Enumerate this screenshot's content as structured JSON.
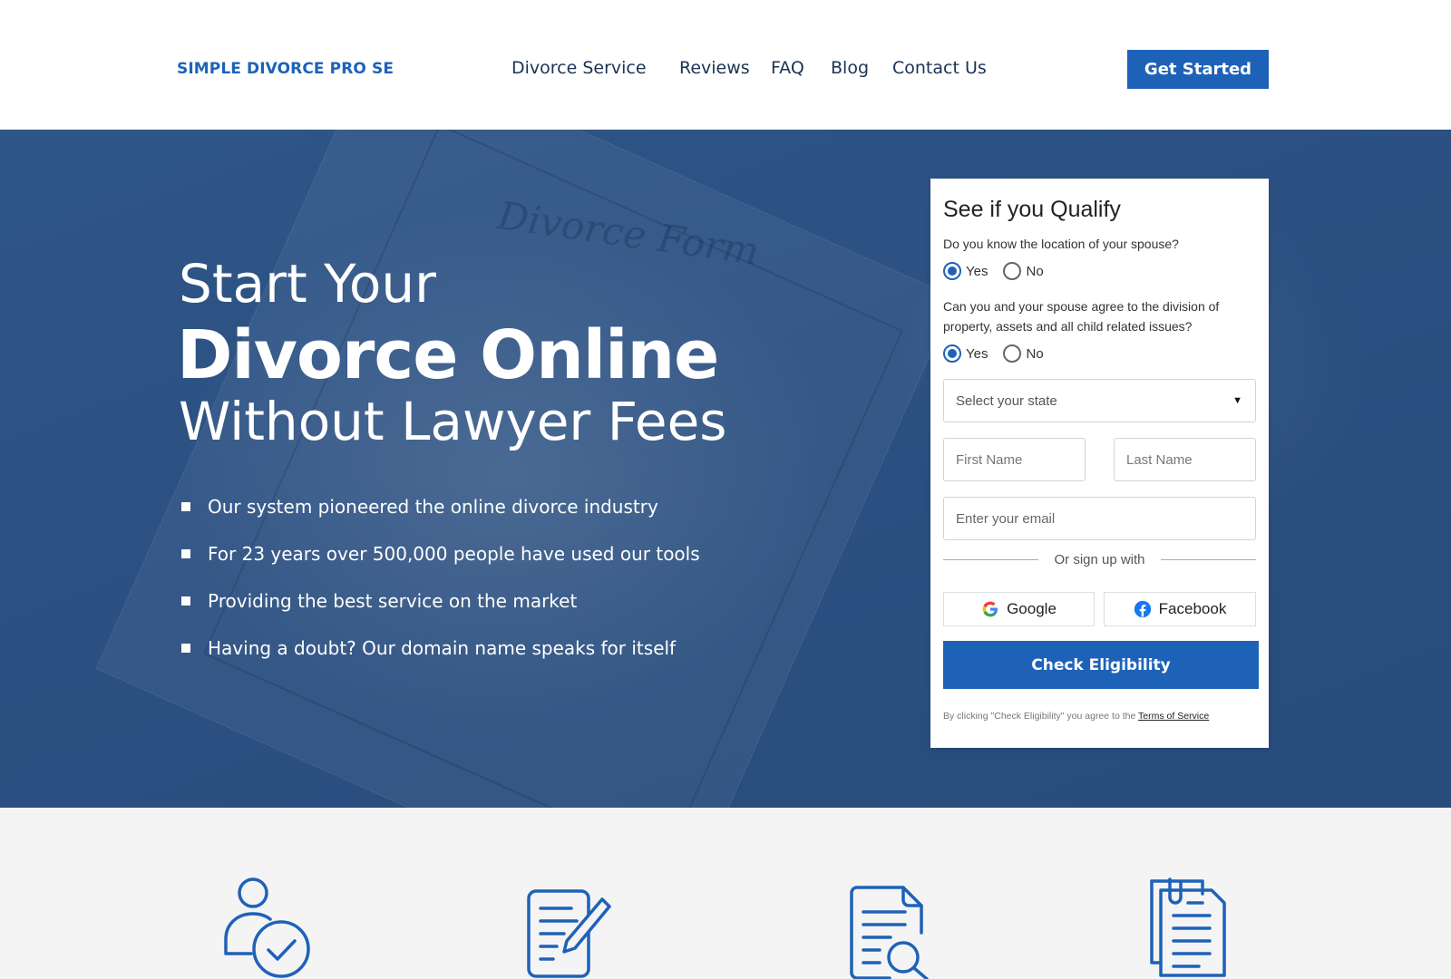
{
  "header": {
    "logo": "SIMPLE DIVORCE PRO SE",
    "nav": [
      "Divorce Service",
      "Reviews",
      "FAQ",
      "Blog",
      "Contact Us"
    ],
    "cta": "Get Started"
  },
  "hero": {
    "line1": "Start Your",
    "line2": "Divorce Online",
    "line3": "Without Lawyer Fees",
    "bullets": [
      "Our system pioneered the online divorce industry",
      "For 23 years over 500,000 people have used our tools",
      "Providing the best service on the market",
      "Having a doubt? Our domain name speaks for itself"
    ],
    "background_text": "Divorce Form"
  },
  "form": {
    "title": "See if you Qualify",
    "q1": "Do you know the location of your spouse?",
    "q2": "Can you and your spouse agree to the division of property, assets and all child related issues?",
    "yes": "Yes",
    "no": "No",
    "q1_selected": "Yes",
    "q2_selected": "Yes",
    "state_placeholder": "Select your state",
    "first_name_placeholder": "First Name",
    "last_name_placeholder": "Last Name",
    "email_placeholder": "Enter your email",
    "divider": "Or sign up with",
    "google": "Google",
    "facebook": "Facebook",
    "submit": "Check Eligibility",
    "terms_prefix": "By clicking \"Check Eligibility\" you agree to the",
    "terms_link": "Terms of Service"
  },
  "features": {
    "icons": [
      "user-check-icon",
      "document-edit-icon",
      "document-search-icon",
      "documents-clip-icon"
    ]
  },
  "colors": {
    "brand": "#1e62b8",
    "hero_bg": "#2c5282",
    "features_bg": "#f4f4f4",
    "nav_text": "#1a3352"
  }
}
